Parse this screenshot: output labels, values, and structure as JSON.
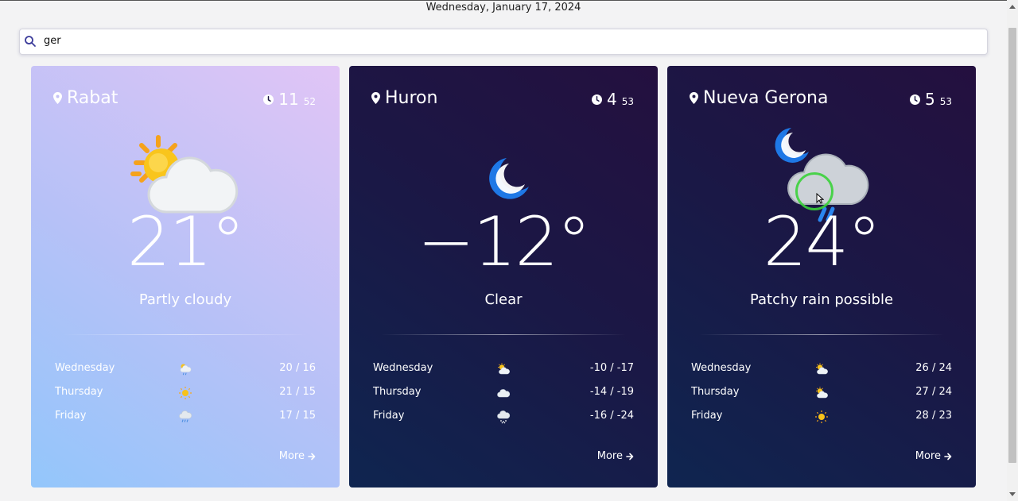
{
  "header": {
    "date": "Wednesday, January 17, 2024"
  },
  "search": {
    "value": "ger"
  },
  "cards": [
    {
      "city": "Rabat",
      "hour": "11",
      "minute": "52",
      "temperature": "21°",
      "condition": "Partly cloudy",
      "icon": "partly-cloudy-day-icon",
      "forecast": [
        {
          "day": "Wednesday",
          "icon": "rain-sun-icon",
          "range": "20 / 16"
        },
        {
          "day": "Thursday",
          "icon": "sun-icon",
          "range": "21 / 15"
        },
        {
          "day": "Friday",
          "icon": "rain-cloud-icon",
          "range": "17 / 15"
        }
      ],
      "more": "More"
    },
    {
      "city": "Huron",
      "hour": "4",
      "minute": "53",
      "temperature": "−12°",
      "condition": "Clear",
      "icon": "moon-icon",
      "forecast": [
        {
          "day": "Wednesday",
          "icon": "partly-cloudy-icon",
          "range": "-10 / -17"
        },
        {
          "day": "Thursday",
          "icon": "cloud-icon",
          "range": "-14 / -19"
        },
        {
          "day": "Friday",
          "icon": "snow-cloud-icon",
          "range": "-16 / -24"
        }
      ],
      "more": "More"
    },
    {
      "city": "Nueva Gerona",
      "hour": "5",
      "minute": "53",
      "temperature": "24°",
      "condition": "Patchy rain possible",
      "icon": "night-rain-icon",
      "forecast": [
        {
          "day": "Wednesday",
          "icon": "partly-cloudy-icon",
          "range": "26 / 24"
        },
        {
          "day": "Thursday",
          "icon": "partly-cloudy-icon",
          "range": "27 / 24"
        },
        {
          "day": "Friday",
          "icon": "sun-icon",
          "range": "28 / 23"
        }
      ],
      "more": "More"
    }
  ],
  "colors": {
    "light_card": [
      "#93c6fb",
      "#e1c5f6"
    ],
    "dark_card": [
      "#0f2550",
      "#24103f"
    ],
    "search_icon": "#3b3b9a"
  }
}
